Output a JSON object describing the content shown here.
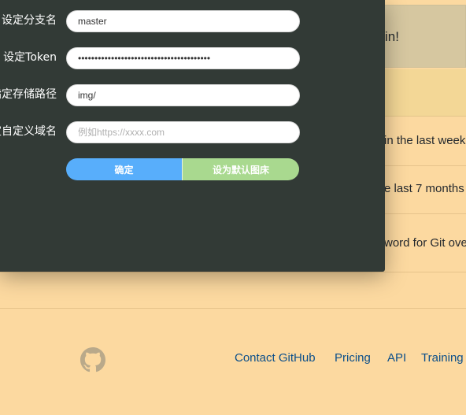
{
  "background": {
    "banner_text": "in!",
    "rows": [
      {
        "text": "in the last week"
      },
      {
        "text": "e last 7 months"
      },
      {
        "text": "word for Git ove"
      }
    ],
    "footer": {
      "links": [
        "Contact GitHub",
        "Pricing",
        "API",
        "Training"
      ]
    }
  },
  "form": {
    "branch": {
      "label": "设定分支名",
      "value": "master"
    },
    "token": {
      "label": "设定Token",
      "required_mark": "*",
      "value": "••••••••••••••••••••••••••••••••••••••••"
    },
    "path": {
      "label": "指定存储路径",
      "value": "img/"
    },
    "domain": {
      "label": "设定自定义域名",
      "value": "",
      "placeholder": "例如https://xxxx.com"
    },
    "confirm_label": "确定",
    "set_default_label": "设为默认图床"
  },
  "colors": {
    "modal_bg": "#323a36",
    "confirm_btn": "#58aefb",
    "default_btn": "#a9d98f",
    "page_bg": "#fcd9a0",
    "link": "#0b4f8a"
  },
  "icons": {
    "footer_logo": "github-mark-icon"
  }
}
